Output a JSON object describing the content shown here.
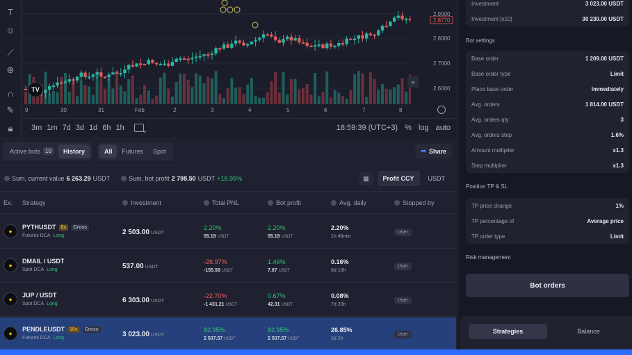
{
  "toolbar_icons": [
    "text-icon",
    "emoji-icon",
    "ruler-icon",
    "zoom-icon",
    "magnet-icon",
    "pencil-lock-icon",
    "lock-icon"
  ],
  "chart": {
    "x_labels": [
      "9",
      "30",
      "31",
      "Feb",
      "2",
      "3",
      "4",
      "5",
      "6",
      "7",
      "8"
    ],
    "price_labels": [
      "2.9000",
      "2.8770",
      "2.8000",
      "2.7000",
      "2.6000"
    ],
    "current_price": "2.8770",
    "colors": {
      "up": "#2bb5a0",
      "down": "#e05a5a",
      "vol_up": "#1f5e5a",
      "vol_down": "#6b2f3a"
    },
    "logo_text": "TV"
  },
  "timeframes": [
    "3m",
    "1m",
    "7d",
    "3d",
    "1d",
    "6h",
    "1h"
  ],
  "clock": "18:59:39 (UTC+3)",
  "chart_options": [
    "%",
    "log",
    "auto"
  ],
  "tabs": {
    "active_bots_label": "Active bots",
    "active_bots_count": "10",
    "history_label": "History",
    "filters": [
      "All",
      "Futures",
      "Spot"
    ],
    "share_label": "Share"
  },
  "summary": {
    "current_value_label": "Sum, current value",
    "current_value": "6 263.29",
    "current_value_unit": "USDT",
    "bot_profit_label": "Sum, bot profit",
    "bot_profit": "2 798.50",
    "bot_profit_unit": "USDT",
    "bot_profit_pct": "+18.95%",
    "profit_ccy_label": "Profit CCY",
    "ccy": "USDT"
  },
  "table": {
    "headers": [
      "Ex.",
      "Strategy",
      "Investment",
      "Total PNL",
      "Bot profit",
      "Avg. daily",
      "Stopped by"
    ],
    "rows": [
      {
        "pair": "PYTHUSDT",
        "leverage": "5x",
        "mode": "Cross",
        "type": "Futures DCA",
        "side": "Long",
        "investment": "2 503.00",
        "inv_unit": "USDT",
        "pnl_pct": "2.20%",
        "pnl_val": "55.19",
        "pnl_unit": "USDT",
        "bp_pct": "2.20%",
        "bp_val": "55.19",
        "bp_unit": "USDT",
        "avg": "2.20%",
        "dur": "1h 48min",
        "stopped": "User",
        "pnl_color": "green"
      },
      {
        "pair": "DMAIL / USDT",
        "leverage": "",
        "mode": "",
        "type": "Spot DCA",
        "side": "Long",
        "investment": "537.00",
        "inv_unit": "USDT",
        "pnl_pct": "-28.97%",
        "pnl_val": "-155.58",
        "pnl_unit": "USDT",
        "bp_pct": "1.46%",
        "bp_val": "7.87",
        "bp_unit": "USDT",
        "avg": "0.16%",
        "dur": "8d 10h",
        "stopped": "User",
        "pnl_color": "red"
      },
      {
        "pair": "JUP / USDT",
        "leverage": "",
        "mode": "",
        "type": "Spot DCA",
        "side": "Long",
        "investment": "6 303.00",
        "inv_unit": "USDT",
        "pnl_pct": "-22.70%",
        "pnl_val": "-1 431.21",
        "pnl_unit": "USDT",
        "bp_pct": "0.67%",
        "bp_val": "42.31",
        "bp_unit": "USDT",
        "avg": "0.08%",
        "dur": "7d 20h",
        "stopped": "User",
        "pnl_color": "red"
      },
      {
        "pair": "PENDLEUSDT",
        "leverage": "10x",
        "mode": "Cross",
        "type": "Futures DCA",
        "side": "Long",
        "investment": "3 023.00",
        "inv_unit": "USDT",
        "pnl_pct": "82.95%",
        "pnl_val": "2 507.57",
        "pnl_unit": "USDT",
        "bp_pct": "82.95%",
        "bp_val": "2 507.57",
        "bp_unit": "USDT",
        "avg": "26.85%",
        "dur": "3d 2h",
        "stopped": "User",
        "pnl_color": "green"
      }
    ]
  },
  "right": {
    "investment_rows": [
      {
        "k": "Investment",
        "v": "3 023.00 USDT"
      },
      {
        "k": "Investment [x10]",
        "v": "30 230.00 USDT"
      }
    ],
    "bot_settings_title": "Bot settings",
    "bot_settings": [
      {
        "k": "Base order",
        "v": "1 209.00 USDT"
      },
      {
        "k": "Base order type",
        "v": "Limit"
      },
      {
        "k": "Place base order",
        "v": "Immediately"
      },
      {
        "k": "Avg. orders",
        "v": "1 814.00 USDT"
      },
      {
        "k": "Avg. orders qty",
        "v": "3"
      },
      {
        "k": "Avg. orders step",
        "v": "1.6%"
      },
      {
        "k": "Amount multiplier",
        "v": "x1.3"
      },
      {
        "k": "Step multiplier",
        "v": "x1.3"
      }
    ],
    "tp_title": "Position TP & SL",
    "tp_rows": [
      {
        "k": "TP price change",
        "v": "1%"
      },
      {
        "k": "TP percentage of",
        "v": "Average price"
      },
      {
        "k": "TP order type",
        "v": "Limit"
      }
    ],
    "risk_title": "Risk management",
    "bot_orders_label": "Bot orders",
    "bottom_tabs": [
      "Strategies",
      "Balance"
    ]
  }
}
